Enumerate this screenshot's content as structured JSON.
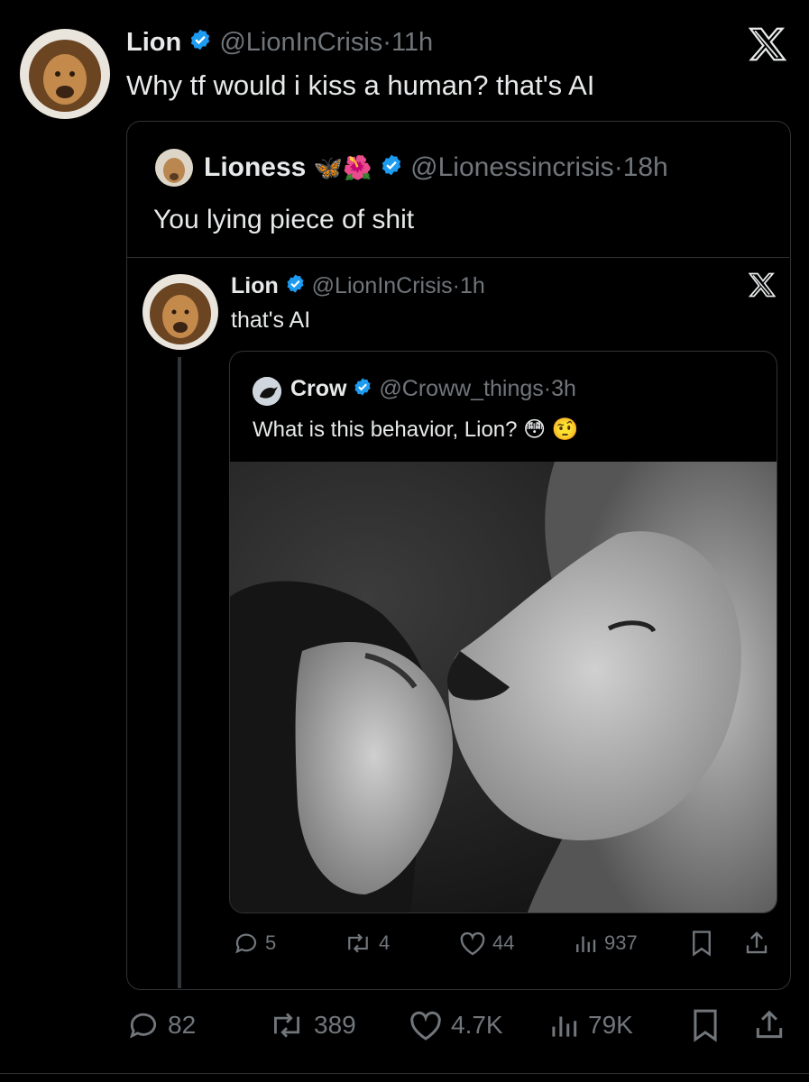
{
  "main_tweet": {
    "author": "Lion",
    "handle": "@LionInCrisis",
    "time": "11h",
    "text": "Why tf would i kiss a human? that's AI",
    "metrics": {
      "replies": "82",
      "retweets": "389",
      "likes": "4.7K",
      "views": "79K"
    }
  },
  "quote_1": {
    "author": "Lioness",
    "author_emoji": "🦋🌺",
    "handle": "@Lionessincrisis",
    "time": "18h",
    "text": "You lying piece of shit"
  },
  "quote_2": {
    "author": "Lion",
    "handle": "@LionInCrisis",
    "time": "1h",
    "text": "that's AI",
    "metrics": {
      "replies": "5",
      "retweets": "4",
      "likes": "44",
      "views": "937"
    }
  },
  "quote_3": {
    "author": "Crow",
    "handle": "@Croww_things",
    "time": "3h",
    "text": "What is this behavior, Lion?",
    "text_emoji": "😳 🤨"
  },
  "separator": "·",
  "colors": {
    "verified": "#1d9bf0",
    "muted": "#71767b",
    "border": "#2f3336"
  }
}
